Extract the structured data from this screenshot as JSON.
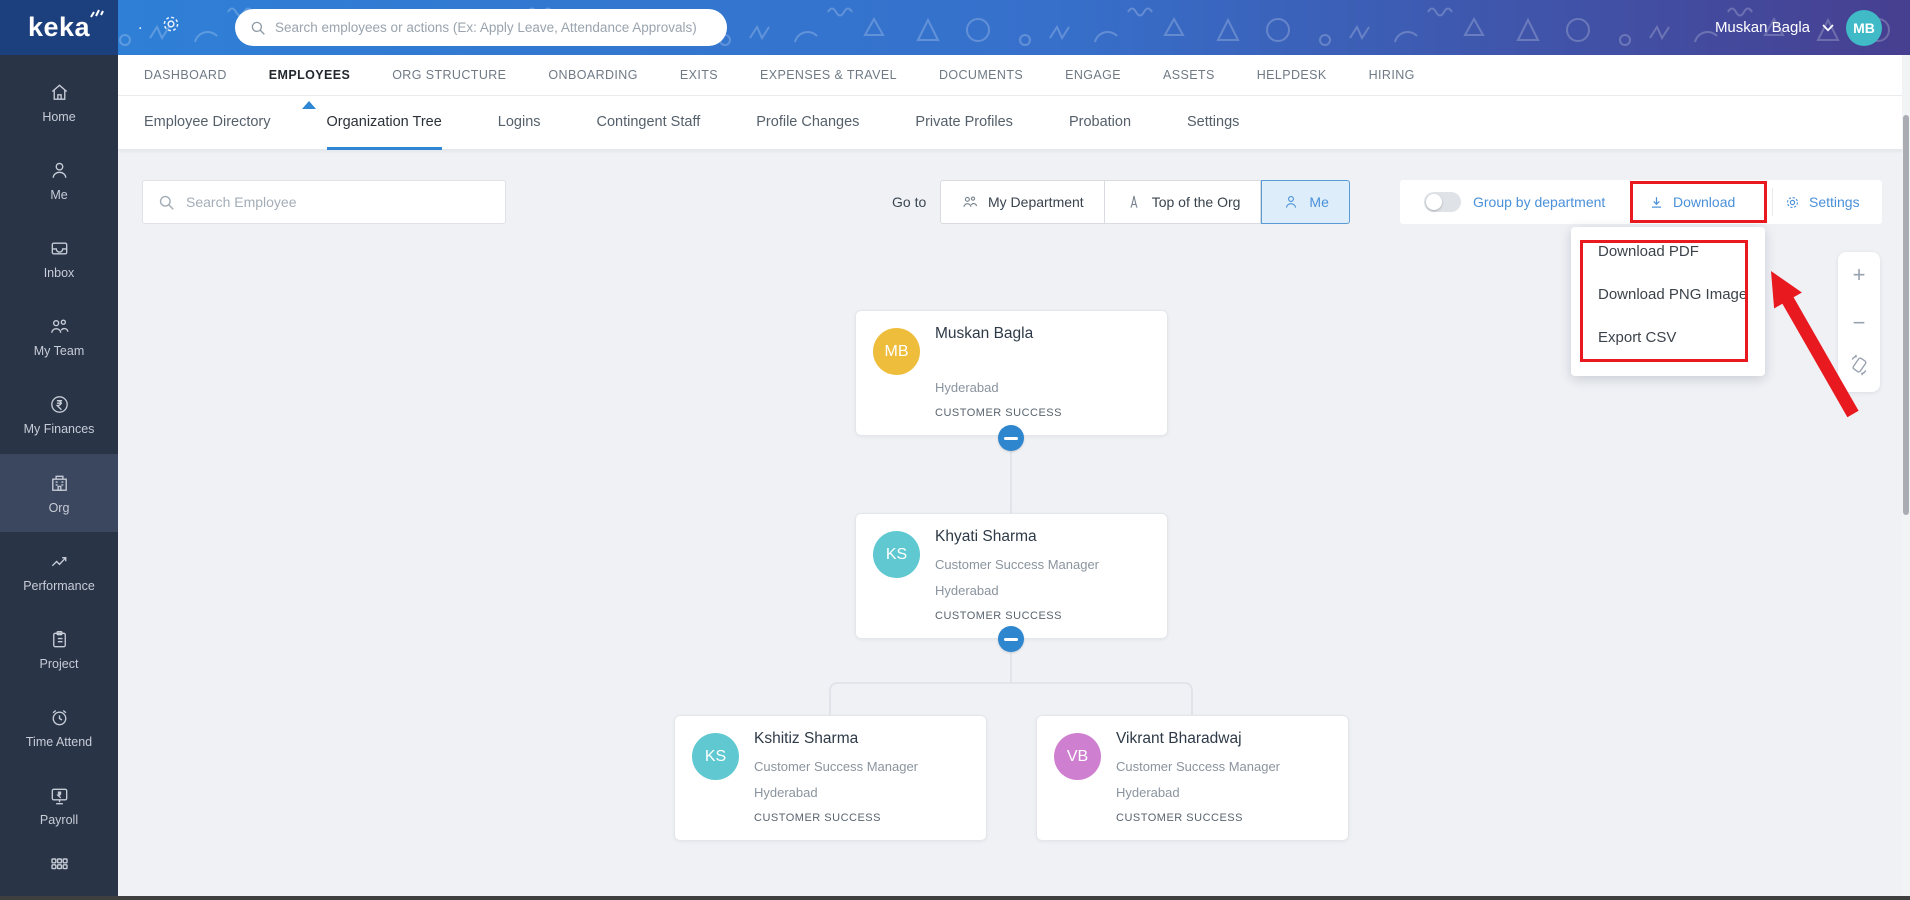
{
  "topbar": {
    "logo_text": "keka",
    "dot": ".",
    "search_placeholder": "Search employees or actions (Ex: Apply Leave, Attendance Approvals)",
    "user_name": "Muskan Bagla",
    "user_initials": "MB"
  },
  "nav": {
    "active_tab": "EMPLOYEES",
    "tabs": [
      {
        "label": "DASHBOARD"
      },
      {
        "label": "EMPLOYEES"
      },
      {
        "label": "ORG STRUCTURE"
      },
      {
        "label": "ONBOARDING"
      },
      {
        "label": "EXITS"
      },
      {
        "label": "EXPENSES & TRAVEL"
      },
      {
        "label": "DOCUMENTS"
      },
      {
        "label": "ENGAGE"
      },
      {
        "label": "ASSETS"
      },
      {
        "label": "HELPDESK"
      },
      {
        "label": "HIRING"
      }
    ]
  },
  "subnav": {
    "active_tab": "Organization Tree",
    "tabs": [
      {
        "label": "Employee Directory"
      },
      {
        "label": "Organization Tree"
      },
      {
        "label": "Logins"
      },
      {
        "label": "Contingent Staff"
      },
      {
        "label": "Profile Changes"
      },
      {
        "label": "Private Profiles"
      },
      {
        "label": "Probation"
      },
      {
        "label": "Settings"
      }
    ]
  },
  "sidebar": {
    "active_item": "Org",
    "items": [
      {
        "label": "Home",
        "icon": "home-icon"
      },
      {
        "label": "Me",
        "icon": "person-icon"
      },
      {
        "label": "Inbox",
        "icon": "inbox-tray-icon"
      },
      {
        "label": "My Team",
        "icon": "people-group-icon"
      },
      {
        "label": "My Finances",
        "icon": "rupee-circle-icon"
      },
      {
        "label": "Org",
        "icon": "building-icon"
      },
      {
        "label": "Performance",
        "icon": "trend-up-icon"
      },
      {
        "label": "Project",
        "icon": "clipboard-icon"
      },
      {
        "label": "Time Attend",
        "icon": "alarm-clock-icon"
      },
      {
        "label": "Payroll",
        "icon": "monitor-rupee-icon"
      }
    ],
    "apps_icon": "apps-grid-icon"
  },
  "toolbar": {
    "search_placeholder": "Search Employee",
    "goto_label": "Go to",
    "my_department_label": "My Department",
    "top_of_org_label": "Top of the Org",
    "me_label": "Me",
    "group_by_label": "Group by department",
    "group_by_toggle_state": "off",
    "download_label": "Download",
    "settings_label": "Settings"
  },
  "download_menu": {
    "items": [
      {
        "label": "Download PDF"
      },
      {
        "label": "Download PNG Image"
      },
      {
        "label": "Export CSV"
      }
    ]
  },
  "org_chart": {
    "nodes": [
      {
        "initials": "MB",
        "name": "Muskan Bagla",
        "title": "",
        "location": "Hyderabad",
        "department": "CUSTOMER SUCCESS",
        "avatar_color": "#eebd3c"
      },
      {
        "initials": "KS",
        "name": "Khyati Sharma",
        "title": "Customer Success Manager",
        "location": "Hyderabad",
        "department": "CUSTOMER SUCCESS",
        "avatar_color": "#5fc8d0"
      },
      {
        "initials": "KS",
        "name": "Kshitiz Sharma",
        "title": "Customer Success Manager",
        "location": "Hyderabad",
        "department": "CUSTOMER SUCCESS",
        "avatar_color": "#5fc8d0"
      },
      {
        "initials": "VB",
        "name": "Vikrant Bharadwaj",
        "title": "Customer Success Manager",
        "location": "Hyderabad",
        "department": "CUSTOMER SUCCESS",
        "avatar_color": "#ce7fd0"
      }
    ]
  },
  "zoom_controls": {
    "zoom_in": "+",
    "zoom_out": "−",
    "rotate_icon": "rotate-device-icon"
  },
  "colors": {
    "accent_blue": "#2f86d2",
    "link_blue": "#4a90d9",
    "annotation_red": "#e8191f",
    "topbar_gradient_start": "#2e81d8",
    "topbar_gradient_end": "#473f90",
    "logo_block": "#1c3f7d",
    "sidebar_bg": "#2a3447",
    "sidebar_active_bg": "#3b475f",
    "content_bg": "#eff1f5",
    "topbar_avatar": "#41bac7",
    "collapse_button_blue": "#2e86cf"
  }
}
